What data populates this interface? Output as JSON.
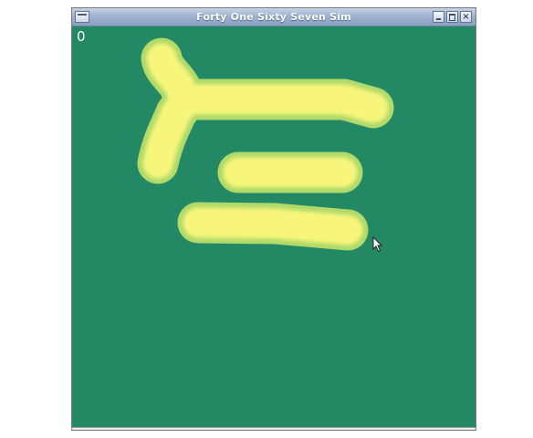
{
  "window": {
    "title": "Forty One Sixty Seven Sim",
    "accent": "#8aa1c2"
  },
  "game": {
    "score": "0",
    "background_color": "#238864",
    "stroke_color_core": "#f6f77a",
    "stroke_color_edge": "#cfe066"
  },
  "icons": {
    "menu": "window-menu-icon",
    "minimize": "minimize-icon",
    "maximize": "maximize-icon",
    "close": "close-icon",
    "cursor": "mouse-pointer-icon"
  }
}
